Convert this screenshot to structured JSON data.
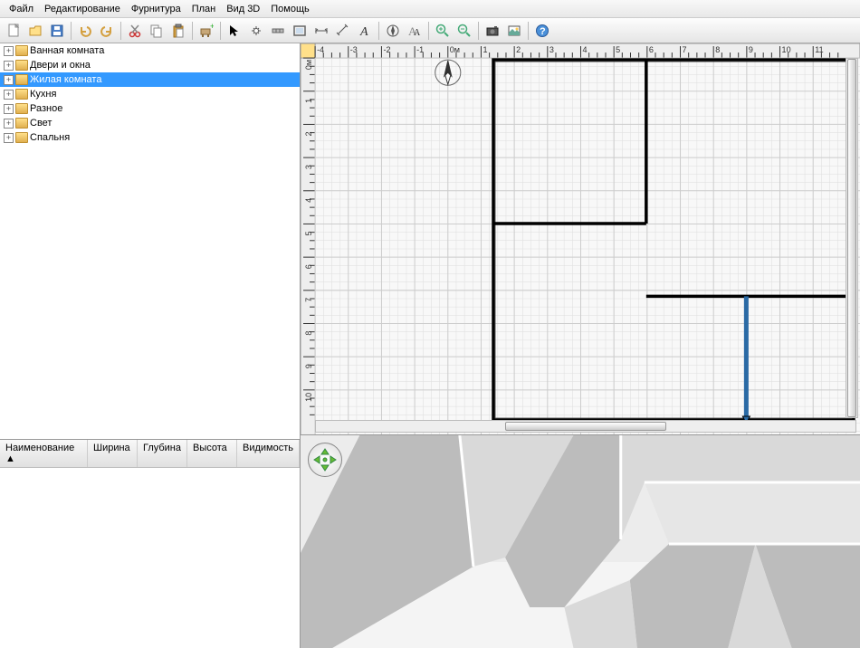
{
  "menu": {
    "items": [
      "Файл",
      "Редактирование",
      "Фурнитура",
      "План",
      "Вид 3D",
      "Помощь"
    ]
  },
  "toolbar_icons": [
    "new-file-icon",
    "open-icon",
    "save-icon",
    "sep",
    "undo-icon",
    "redo-icon",
    "sep",
    "cut-icon",
    "copy-icon",
    "paste-icon",
    "sep",
    "add-furniture-icon",
    "sep",
    "pointer-icon",
    "pan-icon",
    "wall-icon",
    "room-icon",
    "dimension-icon",
    "dimension2-icon",
    "text-icon",
    "sep",
    "compass-icon",
    "text-style-icon",
    "sep",
    "zoom-in-icon",
    "zoom-out-icon",
    "sep",
    "camera-icon",
    "photo-icon",
    "sep",
    "help-icon"
  ],
  "tree": {
    "items": [
      {
        "label": "Ванная комната"
      },
      {
        "label": "Двери и окна"
      },
      {
        "label": "Жилая комната",
        "selected": true
      },
      {
        "label": "Кухня"
      },
      {
        "label": "Разное"
      },
      {
        "label": "Свет"
      },
      {
        "label": "Спальня"
      }
    ]
  },
  "table": {
    "cols": [
      "Наименование ▲",
      "Ширина",
      "Глубина",
      "Высота",
      "Видимость"
    ]
  },
  "plan": {
    "x_ticks": [
      "-4",
      "-3",
      "-2",
      "-1",
      "0м",
      "1",
      "2",
      "3",
      "4",
      "5",
      "6",
      "7",
      "8",
      "9",
      "10",
      "11"
    ],
    "y_ticks": [
      "0м",
      "1",
      "2",
      "3",
      "4",
      "5",
      "6",
      "7",
      "8",
      "9",
      "10"
    ],
    "unit_label": "м"
  }
}
